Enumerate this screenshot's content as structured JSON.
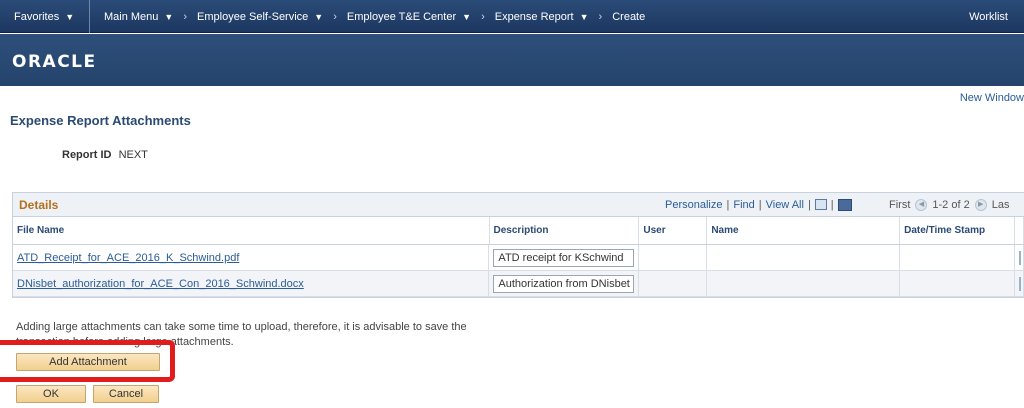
{
  "topbar": {
    "favorites": "Favorites",
    "breadcrumbs": [
      {
        "label": "Main Menu",
        "has_menu": true
      },
      {
        "label": "Employee Self-Service",
        "has_menu": true
      },
      {
        "label": "Employee T&E Center",
        "has_menu": true
      },
      {
        "label": "Expense Report",
        "has_menu": true
      },
      {
        "label": "Create",
        "has_menu": false
      }
    ],
    "worklist": "Worklist"
  },
  "brand": {
    "logo": "ORACLE"
  },
  "new_window": "New Window",
  "page_title": "Expense Report Attachments",
  "report": {
    "label": "Report ID",
    "value": "NEXT"
  },
  "grid": {
    "title": "Details",
    "tools": {
      "personalize": "Personalize",
      "find": "Find",
      "view_all": "View All"
    },
    "nav": {
      "first": "First",
      "range": "1-2 of 2",
      "last": "Las"
    },
    "columns": [
      "File Name",
      "Description",
      "User",
      "Name",
      "Date/Time Stamp"
    ],
    "rows": [
      {
        "file_name": "ATD_Receipt_for_ACE_2016_K_Schwind.pdf",
        "description": "ATD receipt for KSchwind",
        "user": "",
        "name": "",
        "timestamp": ""
      },
      {
        "file_name": "DNisbet_authorization_for_ACE_Con_2016_Schwind.docx",
        "description": "Authorization from DNisbet",
        "user": "",
        "name": "",
        "timestamp": ""
      }
    ]
  },
  "note": "Adding large attachments can take some time to upload, therefore, it is advisable to save the transaction before adding large attachments.",
  "buttons": {
    "add_attachment": "Add Attachment",
    "ok": "OK",
    "cancel": "Cancel"
  },
  "colors": {
    "highlight": "#e01c1c",
    "accent_title": "#b4701c",
    "link": "#2b5c97"
  }
}
